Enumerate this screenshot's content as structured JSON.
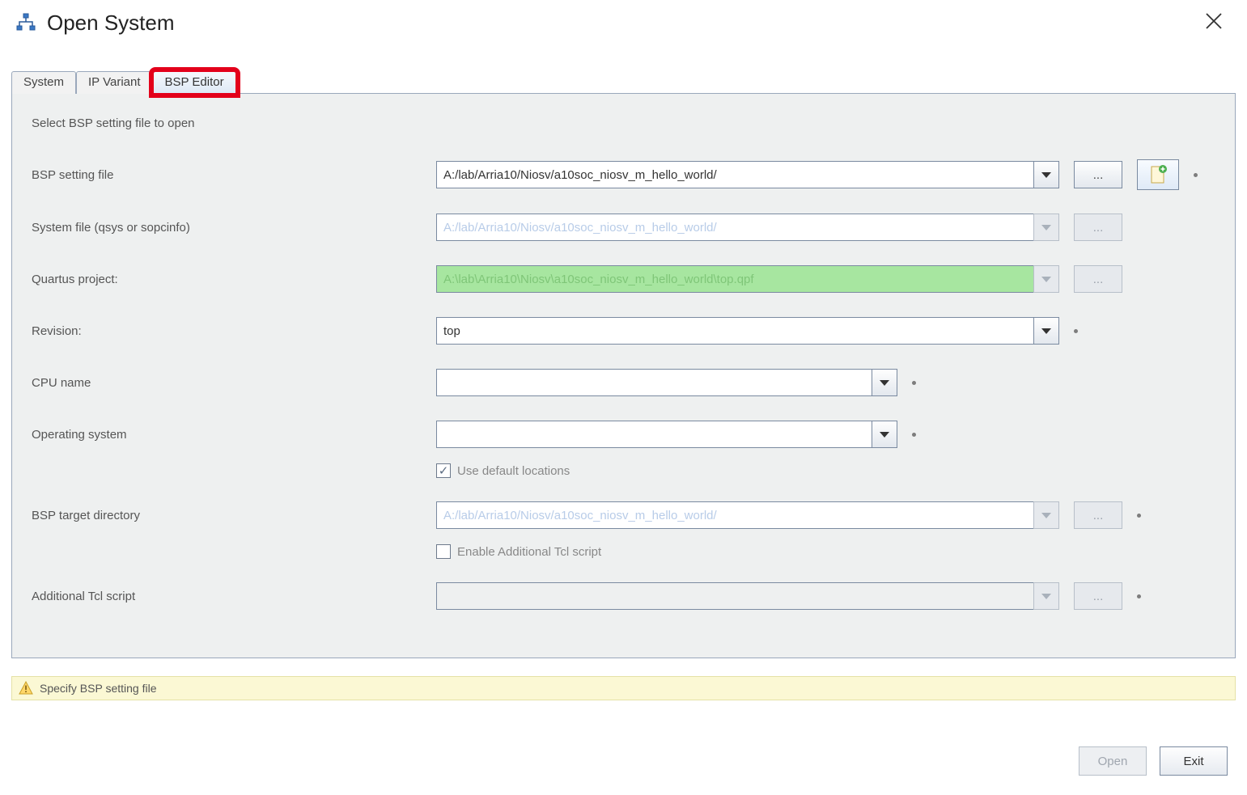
{
  "window": {
    "title": "Open System"
  },
  "tabs": {
    "system": "System",
    "ipvariant": "IP Variant",
    "bspeditor": "BSP Editor"
  },
  "panel": {
    "instruction": "Select BSP setting file to open",
    "labels": {
      "bsp_setting_file": "BSP setting file",
      "system_file": "System file (qsys or sopcinfo)",
      "quartus_project": "Quartus project:",
      "revision": "Revision:",
      "cpu_name": "CPU name",
      "operating_system": "Operating system",
      "bsp_target_dir": "BSP target directory",
      "additional_tcl": "Additional Tcl script"
    },
    "values": {
      "bsp_setting_file": "A:/lab/Arria10/Niosv/a10soc_niosv_m_hello_world/",
      "system_file_placeholder": "A:/lab/Arria10/Niosv/a10soc_niosv_m_hello_world/",
      "quartus_project": "A:\\lab\\Arria10\\Niosv\\a10soc_niosv_m_hello_world\\top.qpf",
      "revision": "top",
      "cpu_name": "",
      "operating_system": "",
      "bsp_target_dir_placeholder": "A:/lab/Arria10/Niosv/a10soc_niosv_m_hello_world/",
      "additional_tcl": ""
    },
    "checkboxes": {
      "use_default_locations": {
        "label": "Use default locations",
        "checked": true
      },
      "enable_additional_tcl": {
        "label": "Enable Additional Tcl script",
        "checked": false
      }
    },
    "browse_label": "..."
  },
  "status": {
    "message": "Specify BSP setting file"
  },
  "footer": {
    "open": "Open",
    "exit": "Exit"
  }
}
